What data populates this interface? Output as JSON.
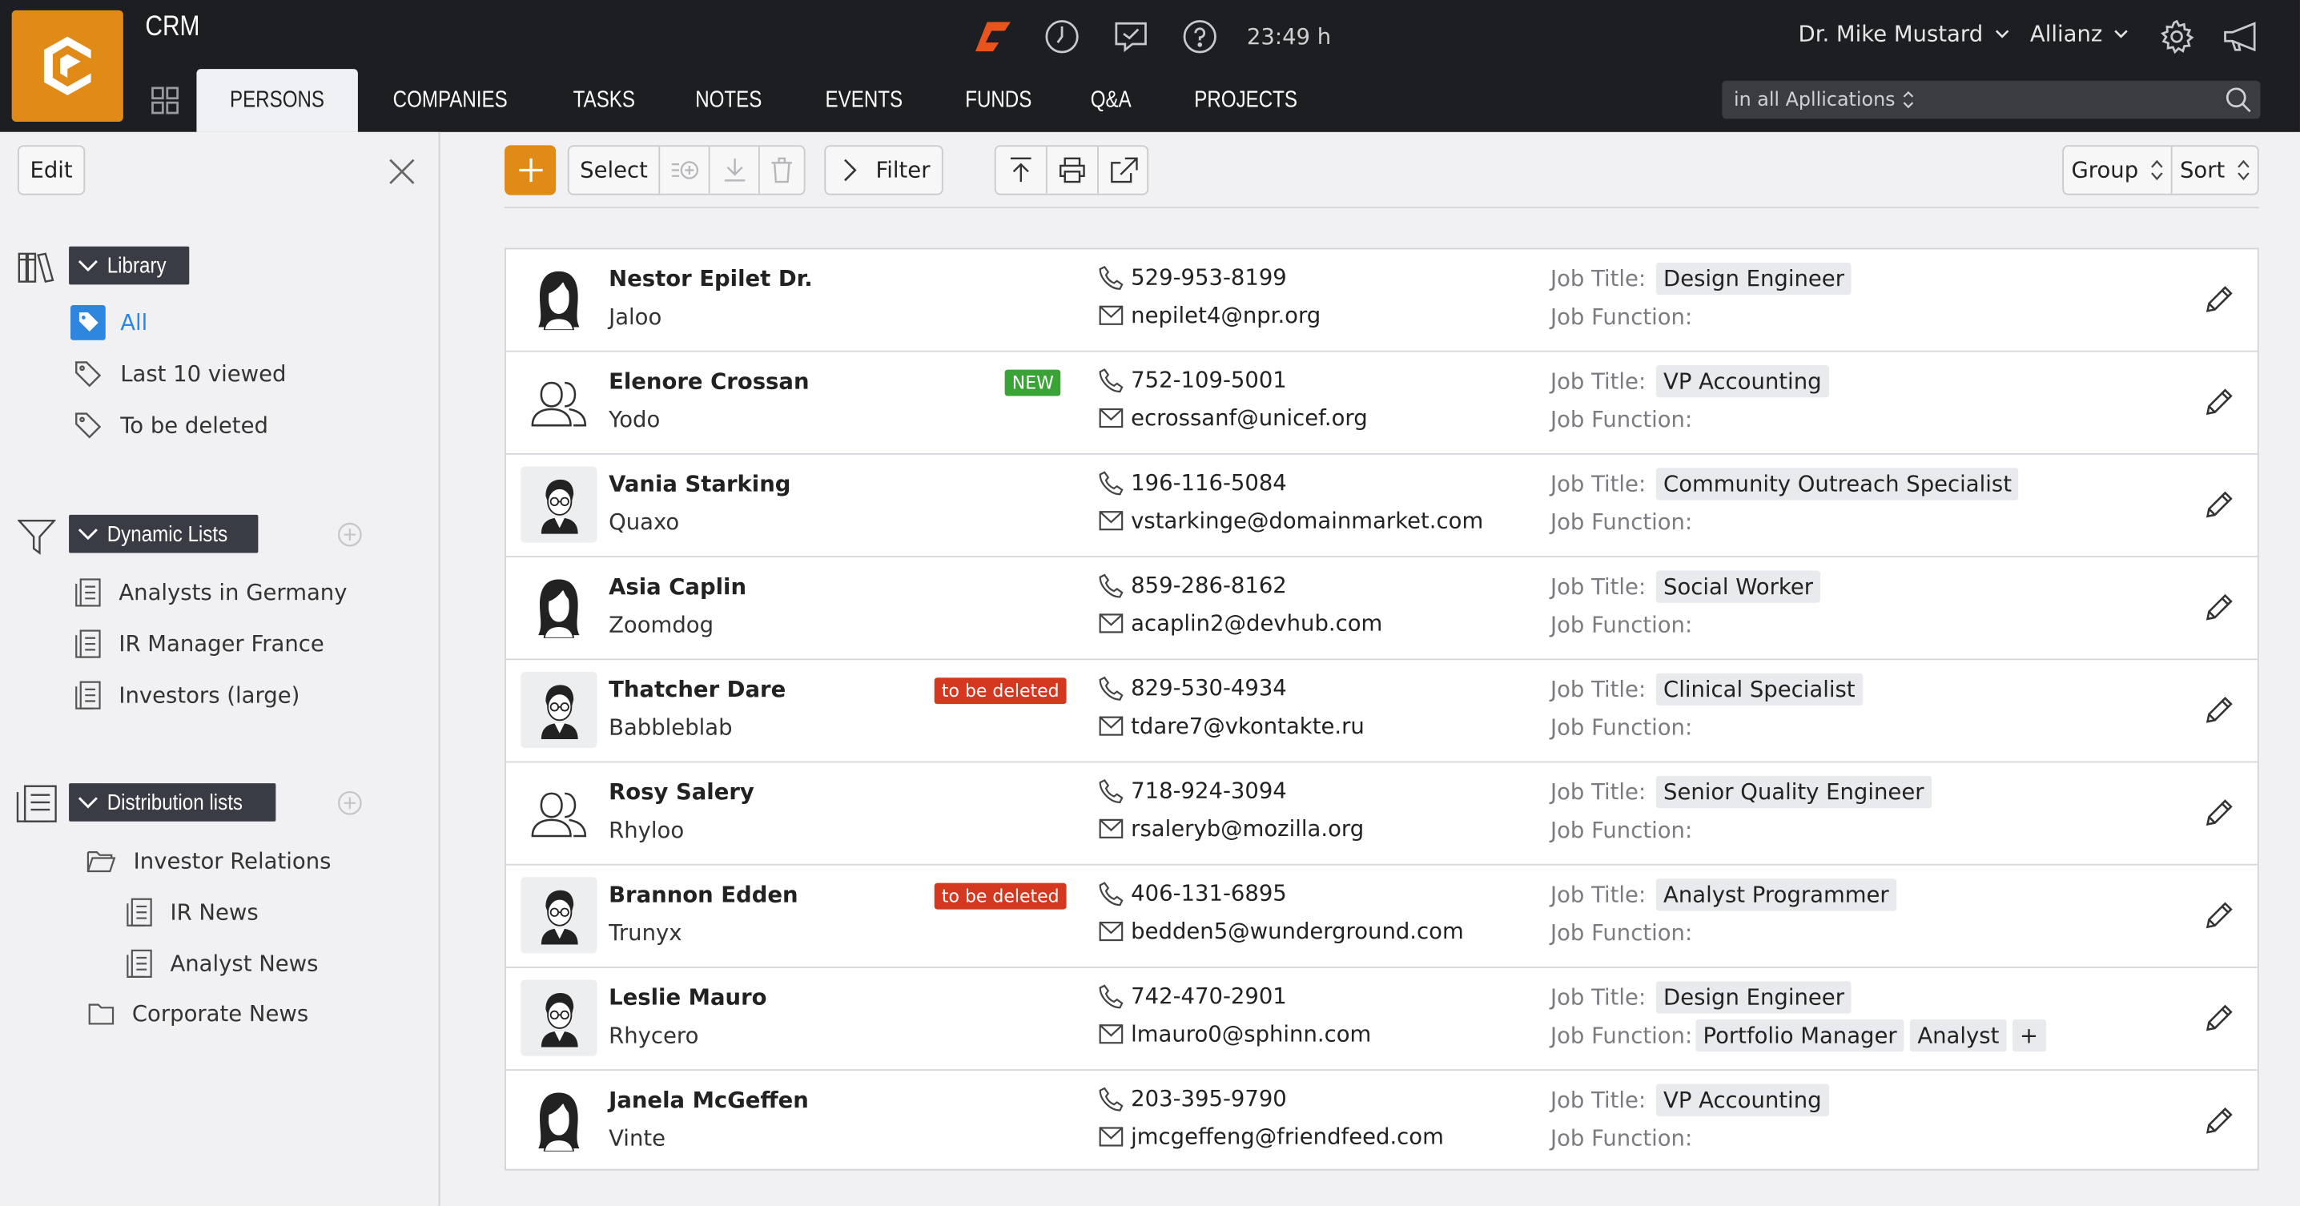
{
  "app": {
    "title": "CRM"
  },
  "colors": {
    "brand": "#e08a17",
    "topbar": "#1d1e22",
    "new_badge": "#3aa336",
    "delete_badge": "#d4381f"
  },
  "nav": {
    "tabs": [
      {
        "label": "PERSONS",
        "active": true
      },
      {
        "label": "COMPANIES"
      },
      {
        "label": "TASKS"
      },
      {
        "label": "NOTES"
      },
      {
        "label": "EVENTS"
      },
      {
        "label": "FUNDS"
      },
      {
        "label": "Q&A"
      },
      {
        "label": "PROJECTS"
      }
    ]
  },
  "header": {
    "time": "23:49 h",
    "user": "Dr. Mike Mustard",
    "org": "Allianz",
    "search_scope": "in all Apllications"
  },
  "sidebar": {
    "edit_label": "Edit",
    "library": {
      "title": "Library",
      "items": [
        "All",
        "Last 10 viewed",
        "To be deleted"
      ]
    },
    "dynamic": {
      "title": "Dynamic Lists",
      "items": [
        "Analysts in Germany",
        "IR Manager France",
        "Investors (large)"
      ]
    },
    "distribution": {
      "title": "Distribution lists",
      "folder": "Investor Relations",
      "sub_items": [
        "IR News",
        "Analyst News"
      ],
      "folder2": "Corporate News"
    }
  },
  "toolbar": {
    "select": "Select",
    "filter": "Filter",
    "group": "Group",
    "sort": "Sort"
  },
  "labels": {
    "job_title": "Job Title:",
    "job_function": "Job Function:"
  },
  "persons": [
    {
      "name": "Nestor Epilet  Dr.",
      "company": "Jaloo",
      "phone": "529-953-8199",
      "email": "nepilet4@npr.org",
      "job_title": "Design Engineer",
      "avatar": "female",
      "badge": ""
    },
    {
      "name": "Elenore Crossan",
      "company": "Yodo",
      "phone": "752-109-5001",
      "email": "ecrossanf@unicef.org",
      "job_title": "VP Accounting",
      "avatar": "outline",
      "badge": "NEW"
    },
    {
      "name": "Vania Starking",
      "company": "Quaxo",
      "phone": "196-116-5084",
      "email": "vstarkinge@domainmarket.com",
      "job_title": "Community Outreach Specialist",
      "avatar": "male",
      "badge": ""
    },
    {
      "name": "Asia Caplin",
      "company": "Zoomdog",
      "phone": "859-286-8162",
      "email": "acaplin2@devhub.com",
      "job_title": "Social Worker",
      "avatar": "female",
      "badge": ""
    },
    {
      "name": "Thatcher Dare",
      "company": "Babbleblab",
      "phone": "829-530-4934",
      "email": "tdare7@vkontakte.ru",
      "job_title": "Clinical Specialist",
      "avatar": "male",
      "badge": "to be deleted"
    },
    {
      "name": "Rosy Salery",
      "company": "Rhyloo",
      "phone": "718-924-3094",
      "email": "rsaleryb@mozilla.org",
      "job_title": "Senior Quality Engineer",
      "avatar": "outline",
      "badge": ""
    },
    {
      "name": "Brannon Edden",
      "company": "Trunyx",
      "phone": "406-131-6895",
      "email": "bedden5@wunderground.com",
      "job_title": "Analyst Programmer",
      "avatar": "male",
      "badge": "to be deleted"
    },
    {
      "name": "Leslie Mauro",
      "company": "Rhycero",
      "phone": "742-470-2901",
      "email": "lmauro0@sphinn.com",
      "job_title": "Design Engineer",
      "avatar": "male",
      "badge": "",
      "job_functions": [
        "Portfolio Manager",
        "Analyst",
        "+"
      ]
    },
    {
      "name": "Janela McGeffen",
      "company": "Vinte",
      "phone": "203-395-9790",
      "email": "jmcgeffeng@friendfeed.com",
      "job_title": "VP Accounting",
      "avatar": "female",
      "badge": ""
    }
  ]
}
